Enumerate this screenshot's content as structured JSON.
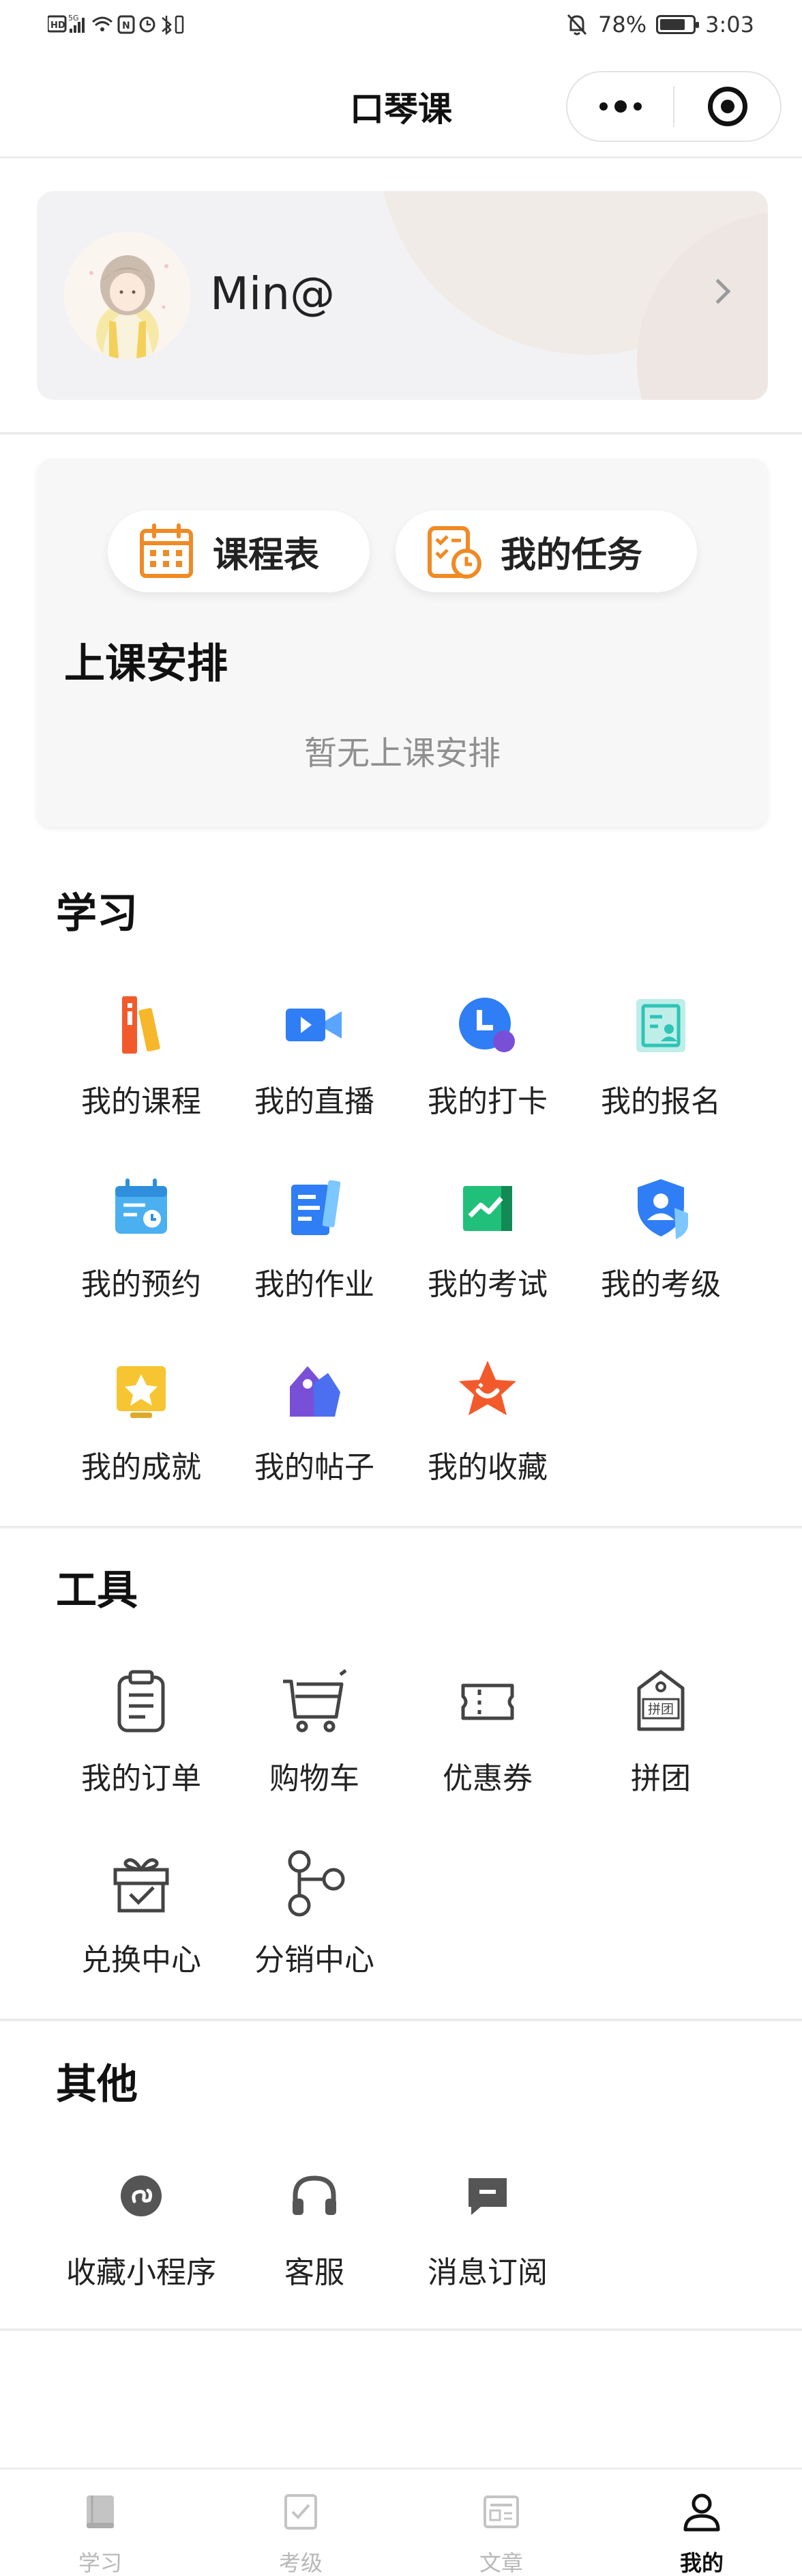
{
  "status_bar": {
    "left_indicators": "HD 5G",
    "battery_percent": "78%",
    "battery_level": 0.78,
    "time": "3:03"
  },
  "nav": {
    "title": "口琴课"
  },
  "profile": {
    "username": "Min@"
  },
  "schedule": {
    "timetable_label": "课程表",
    "tasks_label": "我的任务",
    "title": "上课安排",
    "empty_text": "暂无上课安排"
  },
  "sections": {
    "study": {
      "title": "学习",
      "items": [
        {
          "label": "我的课程",
          "icon": "books-icon"
        },
        {
          "label": "我的直播",
          "icon": "video-camera-icon"
        },
        {
          "label": "我的打卡",
          "icon": "clock-check-icon"
        },
        {
          "label": "我的报名",
          "icon": "signup-form-icon"
        },
        {
          "label": "我的预约",
          "icon": "calendar-clock-icon"
        },
        {
          "label": "我的作业",
          "icon": "homework-icon"
        },
        {
          "label": "我的考试",
          "icon": "chart-exam-icon"
        },
        {
          "label": "我的考级",
          "icon": "shield-user-icon"
        },
        {
          "label": "我的成就",
          "icon": "trophy-icon"
        },
        {
          "label": "我的帖子",
          "icon": "tag-post-icon"
        },
        {
          "label": "我的收藏",
          "icon": "star-favorite-icon"
        }
      ]
    },
    "tools": {
      "title": "工具",
      "items": [
        {
          "label": "我的订单",
          "icon": "clipboard-order-icon"
        },
        {
          "label": "购物车",
          "icon": "shopping-cart-icon"
        },
        {
          "label": "优惠券",
          "icon": "coupon-icon"
        },
        {
          "label": "拼团",
          "icon": "group-buy-tag-icon",
          "icon_text": "拼团"
        },
        {
          "label": "兑换中心",
          "icon": "gift-box-icon"
        },
        {
          "label": "分销中心",
          "icon": "share-nodes-icon"
        }
      ]
    },
    "other": {
      "title": "其他",
      "items": [
        {
          "label": "收藏小程序",
          "icon": "mini-program-icon"
        },
        {
          "label": "客服",
          "icon": "headphones-icon"
        },
        {
          "label": "消息订阅",
          "icon": "message-icon"
        }
      ]
    }
  },
  "tab_bar": {
    "tabs": [
      {
        "label": "学习",
        "icon": "book-icon",
        "active": false
      },
      {
        "label": "考级",
        "icon": "checkbox-icon",
        "active": false
      },
      {
        "label": "文章",
        "icon": "article-icon",
        "active": false
      },
      {
        "label": "我的",
        "icon": "person-icon",
        "active": true
      }
    ]
  },
  "colors": {
    "accent_orange": "#f08a24",
    "blue": "#2f7ef5",
    "teal": "#2ec4b6",
    "green": "#21c07a",
    "purple": "#7a4fd8",
    "yellow": "#f7c531",
    "red_orange": "#f25a2c",
    "tab_inactive": "#b8b8b8",
    "tab_active": "#111111"
  }
}
